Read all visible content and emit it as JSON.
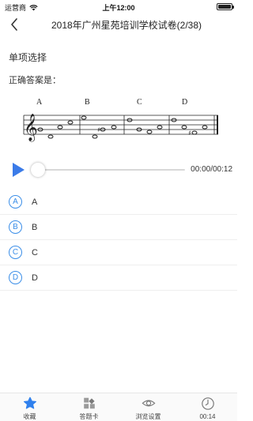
{
  "status_bar": {
    "carrier": "运营商",
    "time": "上午12:00",
    "battery_level": 1.0
  },
  "header": {
    "title": "2018年广州星苑培训学校试卷(2/38)",
    "back_icon": "chevron-left-icon"
  },
  "question": {
    "section_title": "单项选择",
    "prompt": "正确答案是：",
    "staff_labels": [
      "A",
      "B",
      "C",
      "D"
    ]
  },
  "player": {
    "time_display": "00:00/00:12",
    "progress": 0.0,
    "play_icon": "play-icon"
  },
  "options": [
    {
      "letter": "A",
      "text": "A"
    },
    {
      "letter": "B",
      "text": "B"
    },
    {
      "letter": "C",
      "text": "C"
    },
    {
      "letter": "D",
      "text": "D"
    }
  ],
  "tab_bar": {
    "items": [
      {
        "label": "收藏",
        "icon": "star-icon"
      },
      {
        "label": "答题卡",
        "icon": "answer-card-icon"
      },
      {
        "label": "浏览设置",
        "icon": "eye-icon"
      },
      {
        "label": "00:14",
        "icon": "clock-icon"
      }
    ]
  },
  "colors": {
    "accent": "#3b7be8",
    "option_blue": "#3b8ee8",
    "favorite_blue": "#2f80ed"
  }
}
